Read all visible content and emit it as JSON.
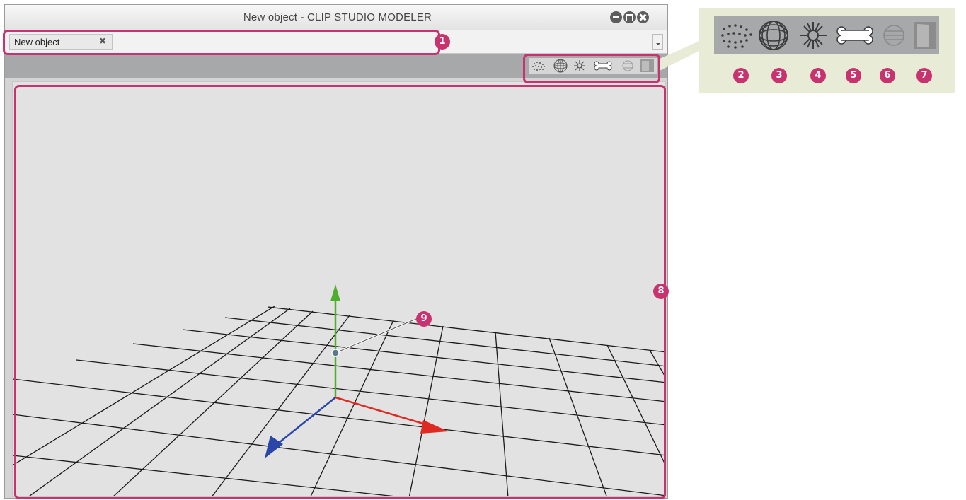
{
  "window": {
    "title": "New object  - CLIP STUDIO MODELER"
  },
  "tabs": [
    {
      "label": "New object",
      "close_icon": "close-x-icon"
    }
  ],
  "toolbar": {
    "icons": [
      "vertex-icon",
      "wireframe-sphere-icon",
      "particle-burst-icon",
      "bone-icon",
      "solid-sphere-icon",
      "flag-icon"
    ]
  },
  "annotations": {
    "badges": [
      "1",
      "2",
      "3",
      "4",
      "5",
      "6",
      "7",
      "8",
      "9"
    ],
    "color": "#c8326e"
  },
  "colors": {
    "axis_x": "#dd2a22",
    "axis_y": "#4fae2c",
    "axis_z": "#2a46a8",
    "callout_bg": "#e8ecd6"
  }
}
